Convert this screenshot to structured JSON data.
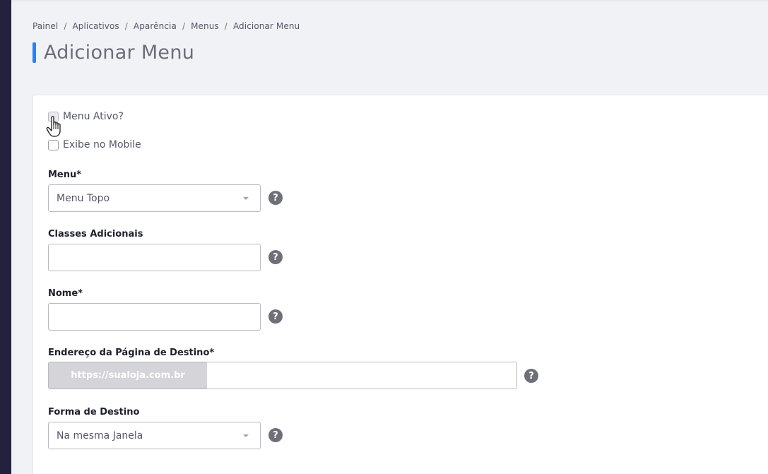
{
  "breadcrumb": [
    "Painel",
    "Aplicativos",
    "Aparência",
    "Menus",
    "Adicionar Menu"
  ],
  "breadcrumb_separator": "/",
  "page": {
    "title": "Adicionar Menu"
  },
  "checkboxes": {
    "ativo": {
      "label": "Menu Ativo?",
      "checked": false
    },
    "mobile": {
      "label": "Exibe no Mobile",
      "checked": false
    }
  },
  "fields": {
    "menu": {
      "label": "Menu*",
      "value": "Menu Topo"
    },
    "classes": {
      "label": "Classes Adicionais",
      "value": ""
    },
    "nome": {
      "label": "Nome*",
      "value": ""
    },
    "endereco": {
      "label": "Endereço da Página de Destino*",
      "prefix": "https://sualoja.com.br",
      "value": ""
    },
    "forma": {
      "label": "Forma de Destino",
      "value": "Na mesma Janela"
    }
  },
  "help_glyph": "?",
  "colors": {
    "accent": "#2f80ed",
    "sidebar": "#24213f",
    "help": "#6f6f79"
  }
}
